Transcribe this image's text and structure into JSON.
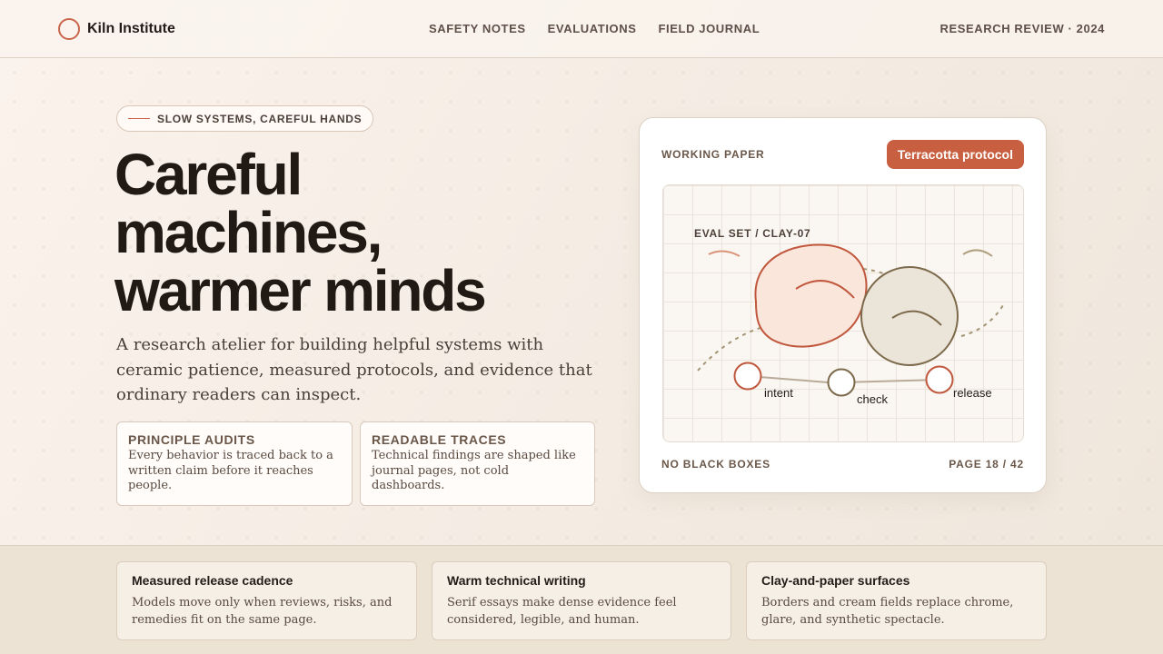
{
  "brand": {
    "name": "Kiln Institute",
    "icon": "circle-ring-icon",
    "accent": "#c8654a"
  },
  "nav": {
    "items": [
      "SAFETY NOTES",
      "EVALUATIONS",
      "FIELD JOURNAL"
    ]
  },
  "header": {
    "edition": "RESEARCH REVIEW · 2024"
  },
  "hero": {
    "eyebrow": "SLOW SYSTEMS, CAREFUL HANDS",
    "headline_lines": [
      "Careful",
      "machines,",
      "warmer minds"
    ],
    "lede": "A research atelier for building helpful systems with ceramic patience, measured protocols, and evidence that ordinary readers can inspect.",
    "cards": [
      {
        "title": "PRINCIPLE AUDITS",
        "body": "Every behavior is traced back to a written claim before it reaches people."
      },
      {
        "title": "READABLE TRACES",
        "body": "Technical findings are shaped like journal pages, not cold dashboards."
      }
    ]
  },
  "paper": {
    "label": "WORKING PAPER",
    "badge": "Terracotta protocol",
    "badge_color": "#c85f40",
    "diagram": {
      "eval_label": "EVAL SET / CLAY-07",
      "nodes": [
        "intent",
        "check",
        "release"
      ]
    },
    "footer_left": "NO BLACK BOXES",
    "footer_right": "PAGE 18 / 42"
  },
  "features": [
    {
      "title": "Measured release cadence",
      "body": "Models move only when reviews, risks, and remedies fit on the same page."
    },
    {
      "title": "Warm technical writing",
      "body": "Serif essays make dense evidence feel considered, legible, and human."
    },
    {
      "title": "Clay-and-paper surfaces",
      "body": "Borders and cream fields replace chrome, glare, and synthetic spectacle."
    }
  ]
}
